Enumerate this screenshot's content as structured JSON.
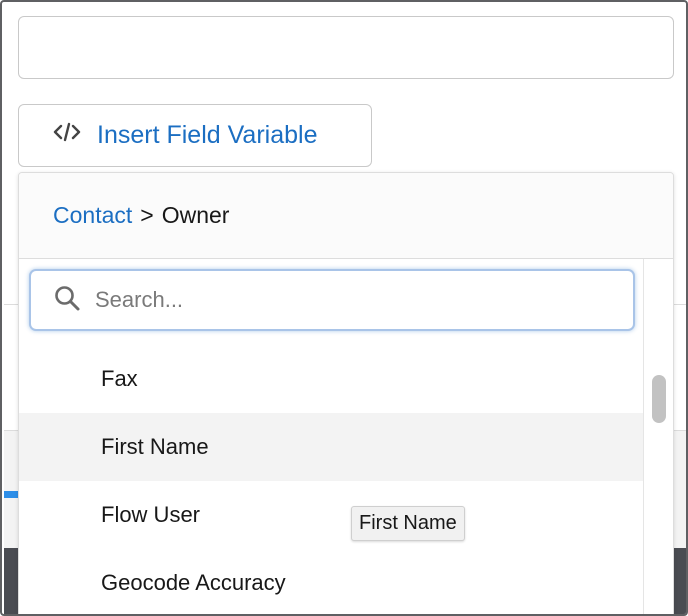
{
  "text_input": {
    "value": ""
  },
  "insert_button": {
    "label": "Insert Field Variable",
    "icon": "code-icon",
    "color": "#1b6ec2"
  },
  "breadcrumb": {
    "link": "Contact",
    "separator": ">",
    "current": "Owner"
  },
  "search": {
    "placeholder": "Search...",
    "value": ""
  },
  "options": [
    {
      "label": "Fax"
    },
    {
      "label": "First Name"
    },
    {
      "label": "Flow User"
    },
    {
      "label": "Geocode Accuracy"
    }
  ],
  "tooltip": {
    "text": "First Name"
  }
}
